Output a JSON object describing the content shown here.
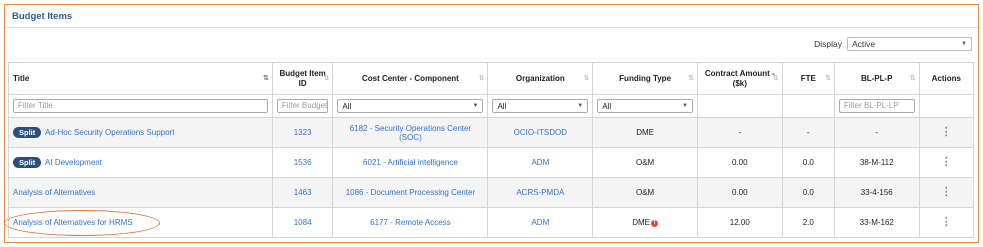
{
  "panel": {
    "title": "Budget Items"
  },
  "display": {
    "label": "Display",
    "value": "Active"
  },
  "columns": [
    {
      "label": "Title"
    },
    {
      "label": "Budget Item ID"
    },
    {
      "label": "Cost Center - Component"
    },
    {
      "label": "Organization"
    },
    {
      "label": "Funding Type"
    },
    {
      "label": "Contract Amount - ($k)"
    },
    {
      "label": "FTE"
    },
    {
      "label": "BL-PL-P"
    },
    {
      "label": "Actions"
    }
  ],
  "filters": {
    "title_placeholder": "Filter Title",
    "id_placeholder": "Filter Budget Item ID",
    "cost_center_value": "All",
    "organization_value": "All",
    "funding_type_value": "All",
    "blplp_placeholder": "Filter BL-PL-LP"
  },
  "rows": [
    {
      "badge": "Split",
      "title": "Ad-Hoc Security Operations Support",
      "id": "1323",
      "cost_center": "6182 - Security Operations Center (SOC)",
      "organization": "OCIO-ITSDOD",
      "funding_type": "DME",
      "contract_amount": "-",
      "fte": "-",
      "blplp": "-"
    },
    {
      "badge": "Split",
      "title": "AI Development",
      "id": "1536",
      "cost_center": "6021 - Artificial intelligence",
      "organization": "ADM",
      "funding_type": "O&M",
      "contract_amount": "0.00",
      "fte": "0.0",
      "blplp": "38-M-112"
    },
    {
      "badge": "",
      "title": "Analysis of Alternatives",
      "id": "1463",
      "cost_center": "1086 - Document Processing Center",
      "organization": "ACRS-PMDA",
      "funding_type": "O&M",
      "contract_amount": "0.00",
      "fte": "0.0",
      "blplp": "33-4-156"
    },
    {
      "badge": "",
      "title": "Analysis of Alternatives for HRMS",
      "id": "1084",
      "cost_center": "6177 - Remote Access",
      "organization": "ADM",
      "funding_type": "DME",
      "contract_amount": "12.00",
      "fte": "2.0",
      "blplp": "33-M-162"
    }
  ],
  "icons": {
    "sort": "sort-arrows-icon",
    "actions": "kebab-menu-icon",
    "warning": "warning-icon"
  },
  "colors": {
    "accent": "#e08a4c",
    "link": "#2f73c9",
    "badge": "#2c4f7c",
    "title": "#2a5b9a"
  }
}
